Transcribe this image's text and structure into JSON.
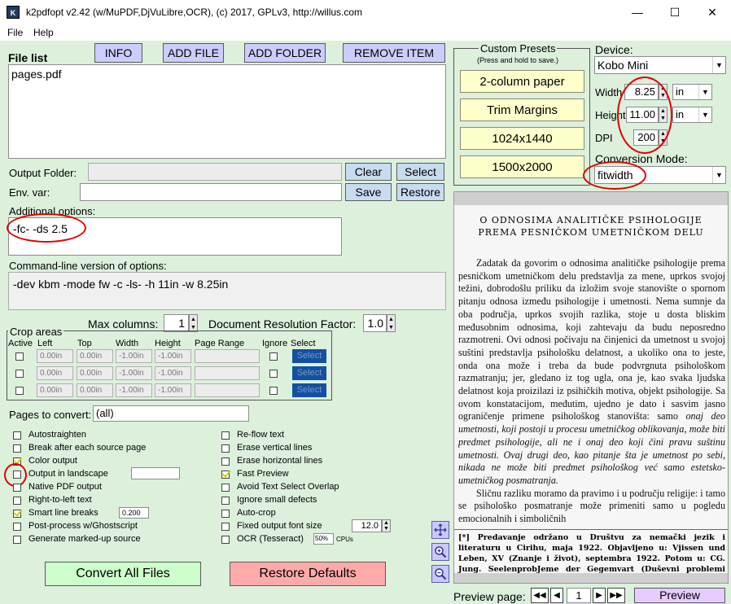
{
  "window": {
    "title": "k2pdfopt v2.42 (w/MuPDF,DjVuLibre,OCR), (c) 2017, GPLv3, http://willus.com",
    "min": "—",
    "max": "☐",
    "close": "✕"
  },
  "menu": {
    "file": "File",
    "help": "Help"
  },
  "toolbar": {
    "info": "INFO",
    "add_file": "ADD FILE",
    "add_folder": "ADD FOLDER",
    "remove_item": "REMOVE ITEM"
  },
  "file_list": {
    "label": "File list",
    "items": [
      "pages.pdf"
    ]
  },
  "output_folder": {
    "label": "Output Folder:",
    "value": "",
    "clear": "Clear",
    "select": "Select"
  },
  "env_var": {
    "label": "Env. var:",
    "value": "",
    "save": "Save",
    "restore": "Restore"
  },
  "additional_options": {
    "label": "Additional options:",
    "value": "-fc- -ds 2.5"
  },
  "command_line": {
    "label": "Command-line version of options:",
    "value": "-dev kbm -mode fw -c -ls- -h 11in -w 8.25in"
  },
  "max_columns": {
    "label": "Max columns:",
    "value": "1"
  },
  "doc_res": {
    "label": "Document Resolution Factor:",
    "value": "1.0"
  },
  "crop": {
    "title": "Crop areas",
    "headers": [
      "Active",
      "Left",
      "Top",
      "Width",
      "Height",
      "Page Range",
      "Ignore",
      "Select"
    ],
    "rows": [
      {
        "left": "0.00in",
        "top": "0.00in",
        "width": "-1.00in",
        "height": "-1.00in",
        "select": "Select"
      },
      {
        "left": "0.00in",
        "top": "0.00in",
        "width": "-1.00in",
        "height": "-1.00in",
        "select": "Select"
      },
      {
        "left": "0.00in",
        "top": "0.00in",
        "width": "-1.00in",
        "height": "-1.00in",
        "select": "Select"
      }
    ]
  },
  "pages_to_convert": {
    "label": "Pages to convert:",
    "value": "(all)"
  },
  "options_left": [
    {
      "label": "Autostraighten",
      "checked": false
    },
    {
      "label": "Break after each source page",
      "checked": false
    },
    {
      "label": "Color output",
      "checked": true
    },
    {
      "label": "Output in landscape",
      "checked": false
    },
    {
      "label": "Native PDF output",
      "checked": false
    },
    {
      "label": "Right-to-left text",
      "checked": false
    },
    {
      "label": "Smart line breaks",
      "checked": true
    },
    {
      "label": "Post-process w/Ghostscript",
      "checked": false
    },
    {
      "label": "Generate marked-up source",
      "checked": false
    }
  ],
  "smart_line_value": "0.200",
  "options_right": [
    {
      "label": "Re-flow text",
      "checked": false
    },
    {
      "label": "Erase vertical lines",
      "checked": false
    },
    {
      "label": "Erase horizontal lines",
      "checked": false
    },
    {
      "label": "Fast Preview",
      "checked": true
    },
    {
      "label": "Avoid Text Select Overlap",
      "checked": false
    },
    {
      "label": "Ignore small defects",
      "checked": false
    },
    {
      "label": "Auto-crop",
      "checked": false
    },
    {
      "label": "Fixed output font size",
      "checked": false
    },
    {
      "label": "OCR (Tesseract)",
      "checked": false
    }
  ],
  "font_size_value": "12.0",
  "ocr_cpu": {
    "value": "50%",
    "unit": "CPUs"
  },
  "convert_all": "Convert All Files",
  "restore_defaults": "Restore Defaults",
  "presets": {
    "title": "Custom Presets",
    "subtitle": "(Press and hold to save.)",
    "items": [
      "2-column paper",
      "Trim Margins",
      "1024x1440",
      "1500x2000"
    ]
  },
  "device": {
    "label": "Device:",
    "value": "Kobo Mini"
  },
  "width": {
    "label": "Width",
    "value": "8.25",
    "unit": "in"
  },
  "height": {
    "label": "Height",
    "value": "11.00",
    "unit": "in"
  },
  "dpi": {
    "label": "DPI",
    "value": "200"
  },
  "conversion_mode": {
    "label": "Conversion Mode:",
    "value": "fitwidth"
  },
  "preview": {
    "title1": "O ODNOSIMA ANALITIČKE PSIHOLOGIJE",
    "title2": "PREMA PESNIČKOM UMETNIČKOM DELU",
    "p1": "Zadatak da govorim o odnosima analitičke psihologije prema pesničkom umetničkom delu predstavlja za mene, uprkos svojoj težini, dobrodošlu priliku da izložim svoje stanovište o spornom pitanju odnosa između psihologije i umetnosti. Nema sumnje da oba područja, uprkos svojih razlika, stoje u dosta bliskim međusobnim odnosima, koji zahtevaju da budu neposredno razmotreni. Ovi odnosi počivaju na činjenici da umetnost u svojoj suštini predstavlja psihološku delatnost, a ukoliko ona to jeste, onda ona može i treba da bude podvrgnuta psihološkom razmatranju; jer, gledano iz tog ugla, ona je, kao svaka ljudska delatnost koja proizilazi iz psihičkih motiva, objekt psihologije. Sa ovom konstatacijom, međutim, ujedno je dato i sasvim jasno ograničenje primene psihološkog stanovišta: samo",
    "p1_italic": "onaj deo umetnosti, koji postoji u procesu umetničkog oblikovanja, može biti predmet psihologije, ali ne i onaj deo koji čini pravu suštinu umetnosti. Ovaj drugi deo, kao pitanje šta je umetnost po sebi, nikada ne može biti predmet psihološkog već samo estetsko-umetničkog posmatranja.",
    "p2": "Sličnu razliku moramo da pravimo i u području religije: i tamo se psihološko posmatranje može primeniti samo u pogledu emocionalnih i simboličnih",
    "note": "[*] Predavanje održano u Društvu za nemački jezik i literaturu u Cirihu, maja 1922. Objavljeno u: Vjissen und Leben, XV (Znanje i život), septembra 1922. Potom u: CG. Jung. SeelenprobJeme der Gegemvart (Duševni problemi dana-"
  },
  "preview_page": {
    "label": "Preview page:",
    "value": "1",
    "button": "Preview"
  },
  "colors": {
    "client_bg": "#dcf0dc",
    "lavender_button": "#ccccff",
    "preset_bg": "#ffffcc",
    "convert_bg": "#ccffcc",
    "restore_bg": "#ffaaaa",
    "highlight_red": "#e00000"
  }
}
